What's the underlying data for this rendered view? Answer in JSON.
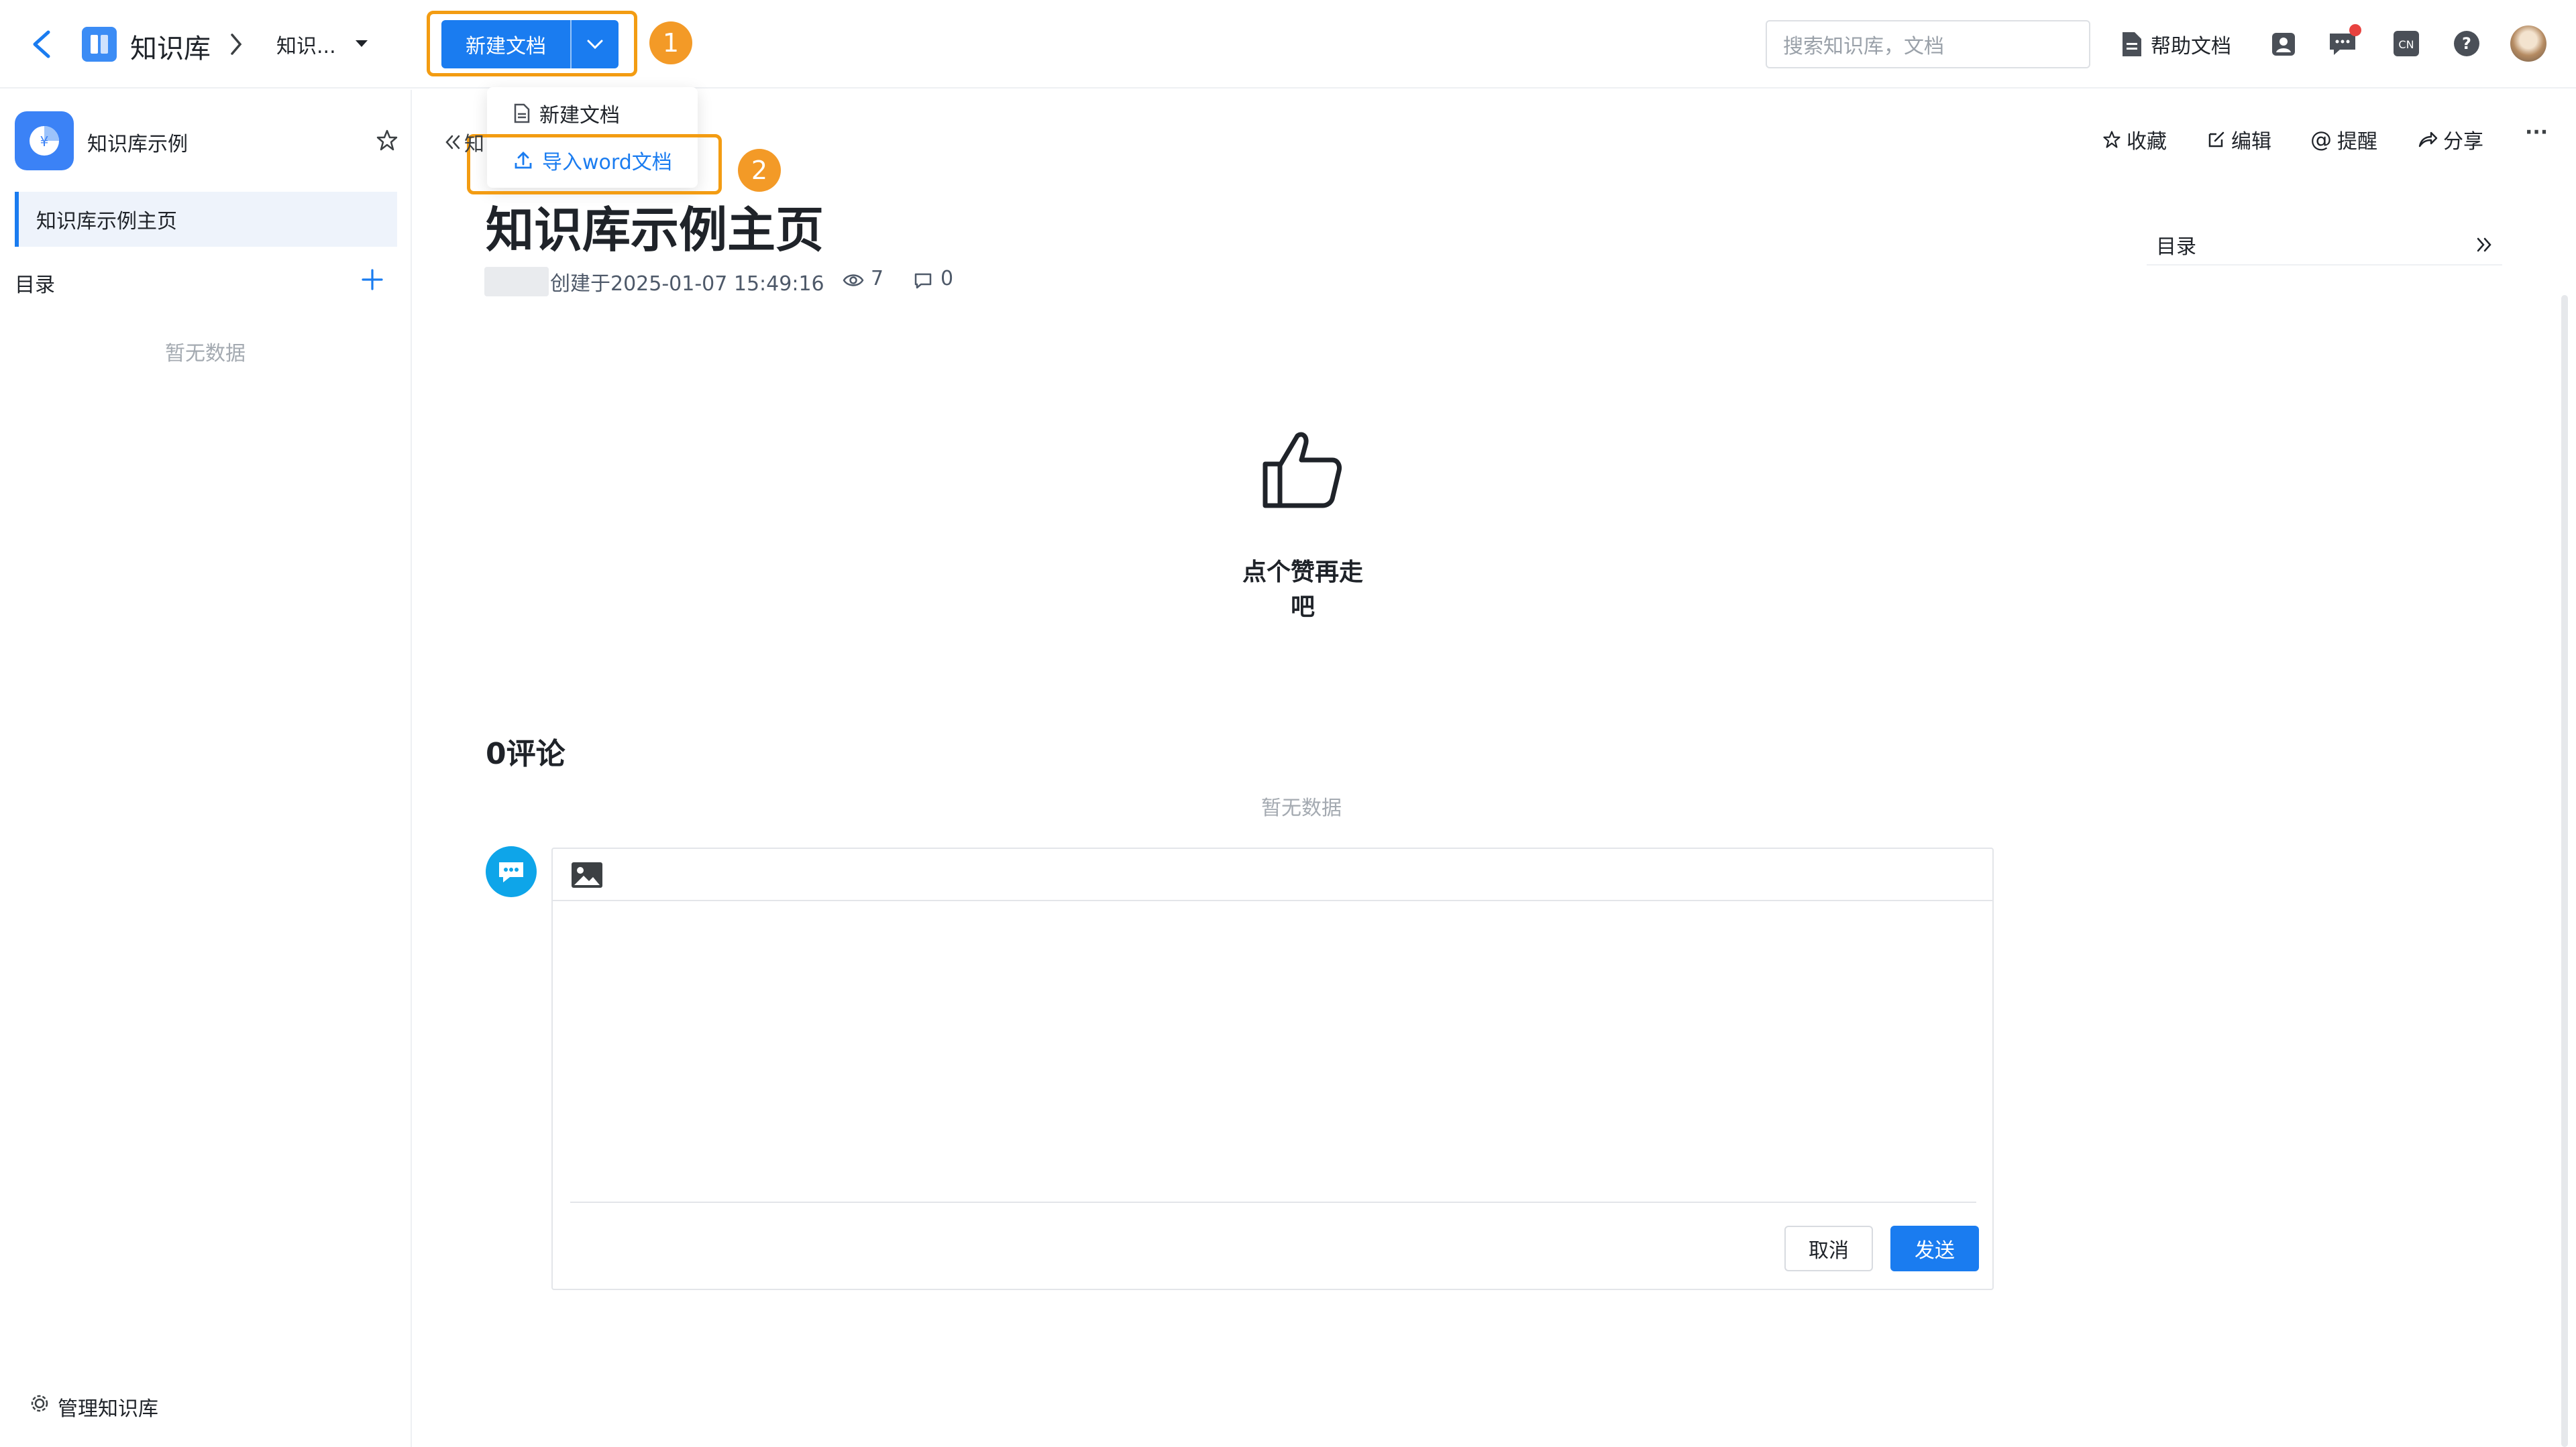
{
  "colors": {
    "primary": "#1a7cf0",
    "highlight_orange": "#f39c12",
    "badge_orange": "#f39a27",
    "muted_text": "#a4aab1",
    "notification_dot": "#e8423f",
    "comment_icon_bg": "#0ea5e9"
  },
  "topbar": {
    "back_icon": "chevron-left-icon",
    "app_icon": "knowledge-book-icon",
    "app_name": "知识库",
    "breadcrumb_current": "知识...",
    "new_doc_button": "新建文档",
    "badge_1": "1",
    "search_placeholder": "搜索知识库，文档",
    "help_docs": "帮助文档",
    "icons": [
      "contact-card-icon",
      "message-icon",
      "language-cn-icon",
      "help-icon",
      "user-avatar"
    ]
  },
  "dropdown": {
    "items": [
      {
        "label": "新建文档",
        "icon": "document-icon"
      },
      {
        "label": "导入word文档",
        "icon": "upload-icon"
      }
    ],
    "badge_2": "2"
  },
  "sidebar": {
    "kb_icon": "knowledge-base-logo",
    "kb_name": "知识库示例",
    "selected_item": "知识库示例主页",
    "toc_label": "目录",
    "empty_text": "暂无数据",
    "manage_label": "管理知识库"
  },
  "content": {
    "collapse_crumb": "知",
    "title": "知识库示例主页",
    "created": "创建于2025-01-07 15:49:16",
    "views": "7",
    "comments_count": "0",
    "toolbar": {
      "favorite": "收藏",
      "edit": "编辑",
      "remind": "提醒",
      "share": "分享",
      "more": "···"
    },
    "toc_title": "目录",
    "like_text": "点个赞再走吧",
    "comments_title": "0评论",
    "comments_empty": "暂无数据",
    "cancel": "取消",
    "send": "发送"
  }
}
